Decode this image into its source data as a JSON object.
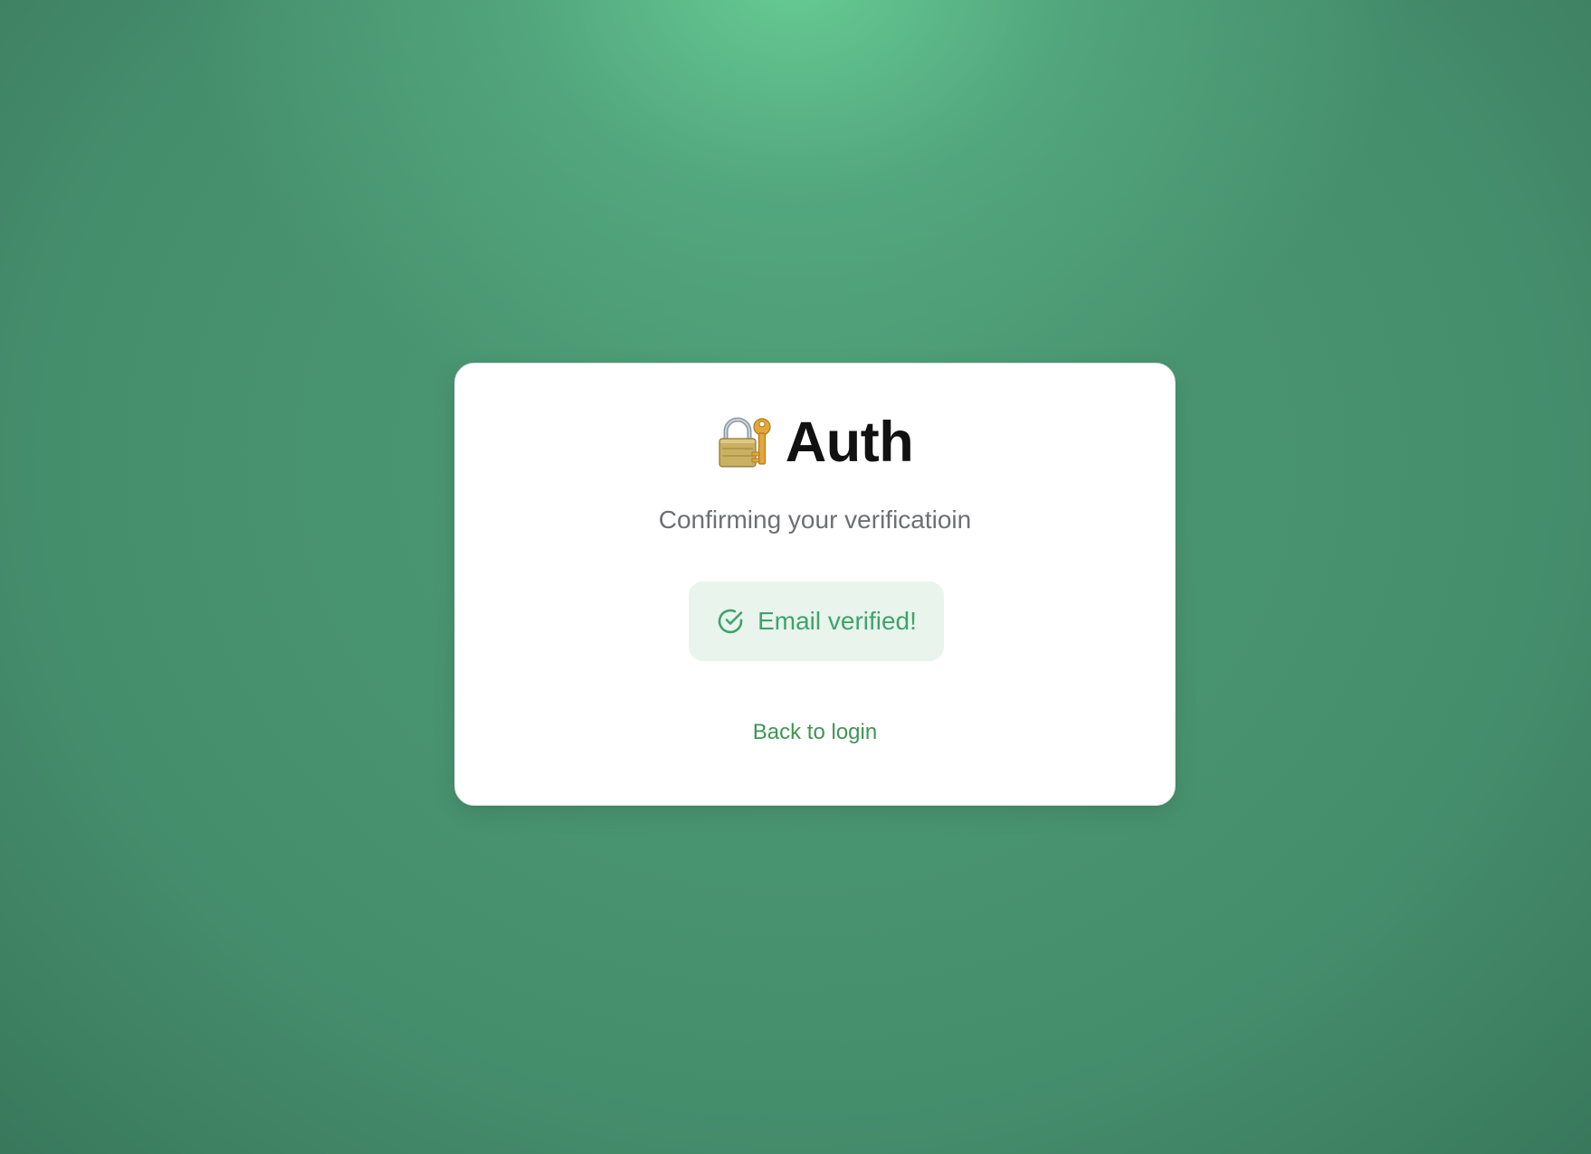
{
  "card": {
    "title": "Auth",
    "title_icon": "lock-with-key-icon",
    "subtitle": "Confirming your verificatioin"
  },
  "status": {
    "text": "Email verified!",
    "icon": "check-circle-icon",
    "color": "#3fa36b",
    "background": "#e8f4ec"
  },
  "links": {
    "back_to_login": "Back to login"
  },
  "colors": {
    "accent": "#3f9553",
    "background_gradient_light": "#68ce96",
    "background_gradient_dark": "#326a52"
  }
}
